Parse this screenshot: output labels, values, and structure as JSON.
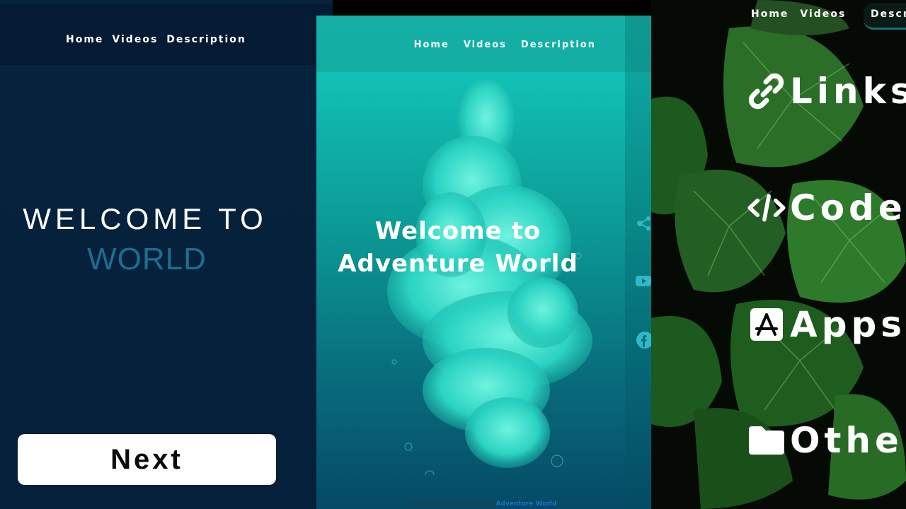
{
  "panel_left": {
    "nav": [
      "Home",
      "Videos",
      "Description"
    ],
    "welcome_line1": "WELCOME TO",
    "welcome_line2": "WORLD",
    "next_button": "Next"
  },
  "panel_middle": {
    "nav": [
      "Home",
      "Videos",
      "Description"
    ],
    "welcome_line1": "Welcome to",
    "welcome_line2": "Adventure World",
    "footer_text": "Design And Developed By ",
    "footer_brand": "Adventure World",
    "social_icons": [
      "share-icon",
      "youtube-icon",
      "facebook-icon"
    ]
  },
  "panel_right": {
    "nav": [
      "Home",
      "Videos"
    ],
    "nav_active": "Descr",
    "menu": [
      {
        "icon": "link-icon",
        "label": "Links"
      },
      {
        "icon": "code-icon",
        "label": "Code"
      },
      {
        "icon": "app-store-icon",
        "label": "Apps"
      },
      {
        "icon": "folder-icon",
        "label": "Other"
      }
    ]
  },
  "colors": {
    "left_bg": "#05213b",
    "world_accent": "#1f6d8e",
    "middle_teal": "#15cfc0",
    "footer_brand": "#1e6fd0"
  }
}
